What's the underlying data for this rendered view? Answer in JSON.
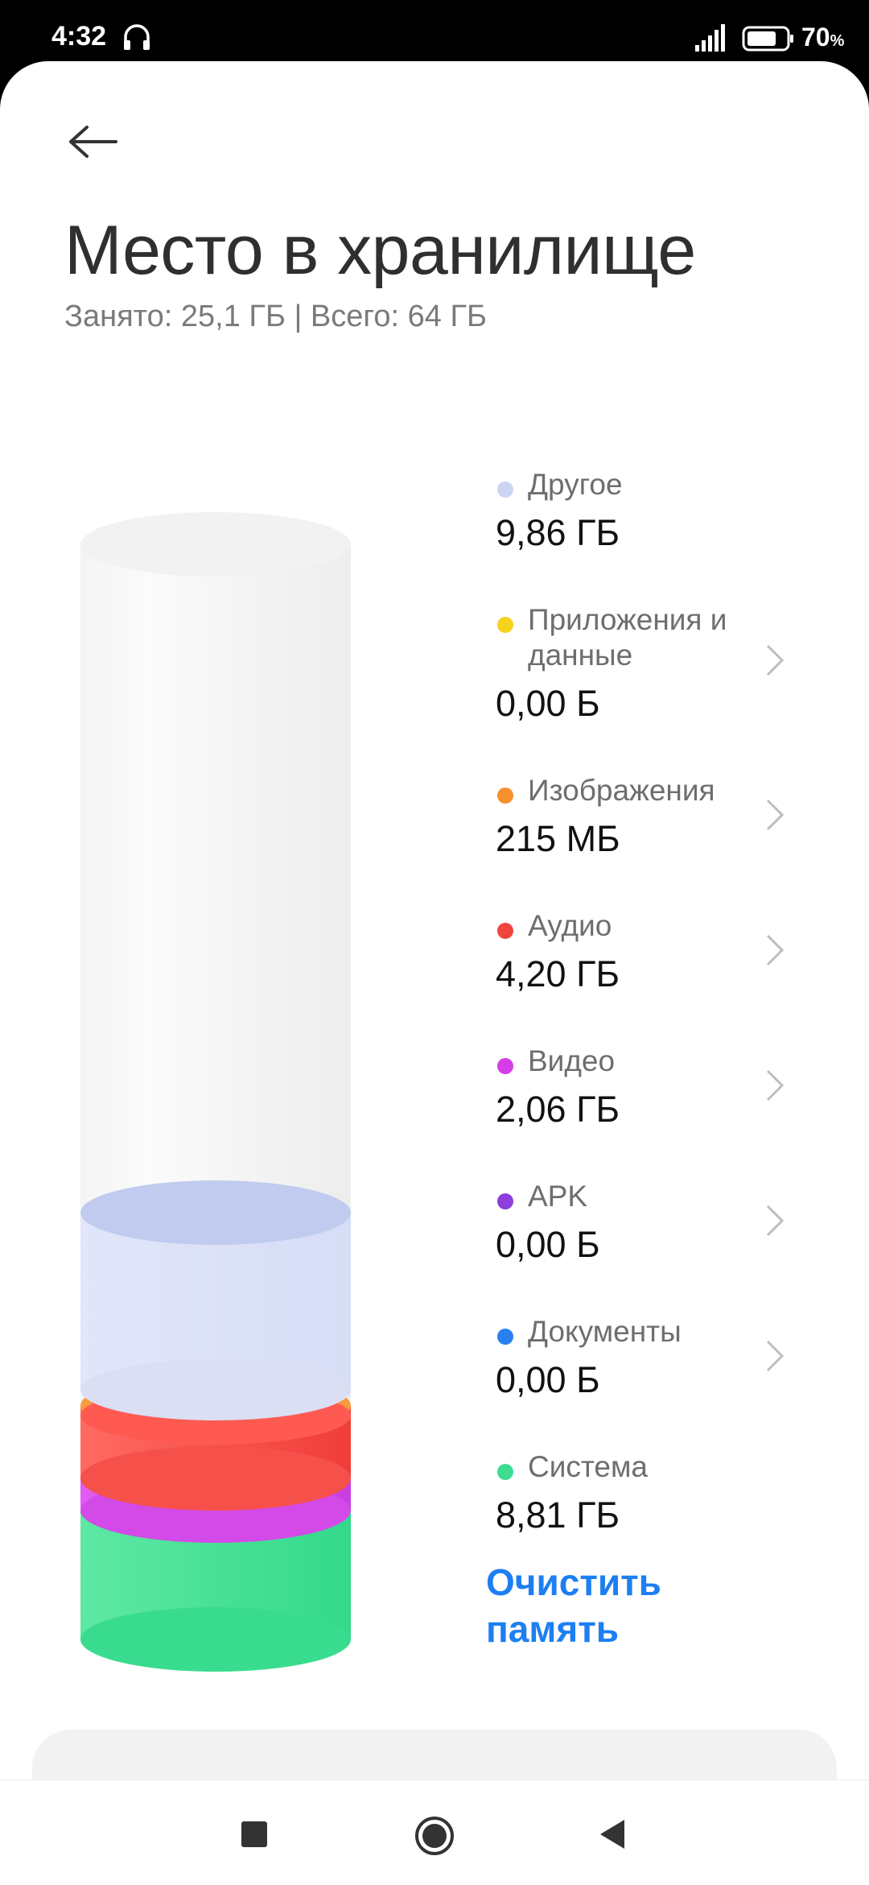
{
  "status_bar": {
    "time": "4:32",
    "battery": "70",
    "battery_unit": "%"
  },
  "header": {
    "title": "Место в хранилище",
    "subtitle": "Занято: 25,1 ГБ | Всего: 64 ГБ"
  },
  "categories": [
    {
      "label": "Другое",
      "value": "9,86 ГБ",
      "color": "#cdd5f2",
      "has_chevron": false
    },
    {
      "label": "Приложения и данные",
      "value": "0,00 Б",
      "color": "#f5d21e",
      "has_chevron": true
    },
    {
      "label": "Изображения",
      "value": "215 МБ",
      "color": "#f7902e",
      "has_chevron": true
    },
    {
      "label": "Аудио",
      "value": "4,20 ГБ",
      "color": "#f0453f",
      "has_chevron": true
    },
    {
      "label": "Видео",
      "value": "2,06 ГБ",
      "color": "#d43ee6",
      "has_chevron": true
    },
    {
      "label": "APK",
      "value": "0,00 Б",
      "color": "#8c3fdc",
      "has_chevron": true
    },
    {
      "label": "Документы",
      "value": "0,00 Б",
      "color": "#2a7ff0",
      "has_chevron": true
    },
    {
      "label": "Система",
      "value": "8,81 ГБ",
      "color": "#3ddc91",
      "has_chevron": false
    }
  ],
  "actions": {
    "clean_label": "Очистить память"
  },
  "icons": {
    "back": "arrow-left-icon",
    "chevron": "chevron-right-icon",
    "nav_recents": "square-icon",
    "nav_home": "circle-icon",
    "nav_back": "triangle-icon"
  }
}
